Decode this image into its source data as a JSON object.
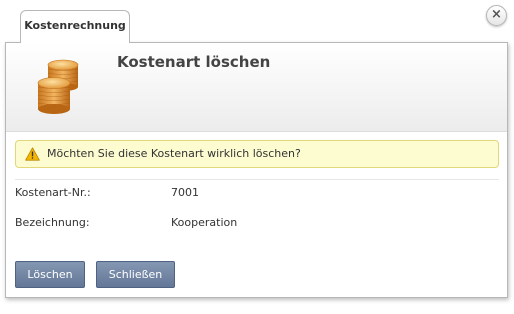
{
  "tab": {
    "label": "Kostenrechnung"
  },
  "dialog": {
    "title": "Kostenart löschen",
    "close_label": "×"
  },
  "warning": {
    "text": "Möchten Sie diese Kostenart wirklich löschen?"
  },
  "fields": [
    {
      "label": "Kostenart-Nr.:",
      "value": "7001"
    },
    {
      "label": "Bezeichnung:",
      "value": "Kooperation"
    }
  ],
  "buttons": {
    "delete_label": "Löschen",
    "close_label": "Schließen"
  },
  "icons": {
    "header": "coins-icon",
    "warning": "warning-icon",
    "close": "close-icon"
  },
  "colors": {
    "button": "#6f82a2",
    "warning_bg": "#fdfbd0",
    "warning_border": "#e2d77a",
    "coin": "#e69a3a"
  }
}
